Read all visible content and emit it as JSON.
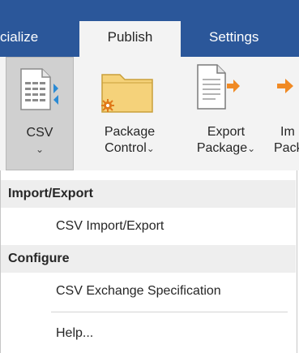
{
  "tabs": [
    {
      "label": "cialize"
    },
    {
      "label": "Publish"
    },
    {
      "label": "Settings"
    }
  ],
  "ribbon": {
    "csv": {
      "label": "CSV",
      "caret": "⌄",
      "icon": "csv-file-icon"
    },
    "package_control": {
      "line1": "Package",
      "line2": "Control",
      "caret": "⌄",
      "icon": "package-folder-icon"
    },
    "export_package": {
      "line1": "Export",
      "line2": "Package",
      "caret": "⌄",
      "icon": "export-document-icon"
    },
    "import_package": {
      "line1": "Im",
      "line2": "Pack",
      "icon": "import-arrow-icon"
    }
  },
  "menu": {
    "header_import_export": "Import/Export",
    "item_csv_import_export": "CSV Import/Export",
    "header_configure": "Configure",
    "item_csv_exchange_spec": "CSV Exchange Specification",
    "item_help": "Help..."
  },
  "colors": {
    "tab_strip": "#2b579a",
    "ribbon_bg": "#f3f3f3",
    "arrow_orange": "#f08a24",
    "folder_yellow": "#f5d27a"
  }
}
